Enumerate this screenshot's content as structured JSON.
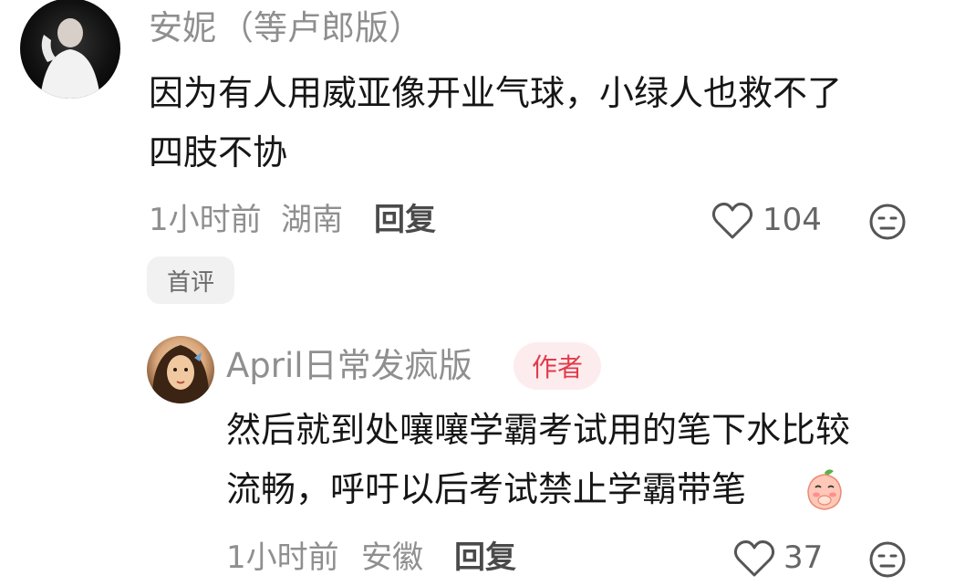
{
  "comments": [
    {
      "username": "安妮",
      "user_suffix": "（等卢郎版）",
      "text_lines": [
        "因为有人用威亚像开业气球，小绿人也救不了",
        "四肢不协"
      ],
      "time": "1小时前",
      "location": "湖南",
      "reply_label": "回复",
      "like_count": "104",
      "tag": "首评"
    },
    {
      "username": "April日常发疯版",
      "badge": "作者",
      "text_lines": [
        "然后就到处嚷嚷学霸考试用的笔下水比较",
        "流畅，呼吁以后考试禁止学霸带笔"
      ],
      "time": "1小时前",
      "location": "安徽",
      "reply_label": "回复",
      "like_count": "37"
    }
  ],
  "icons": {
    "like": "heart-outline-icon",
    "dislike": "unhappy-face-icon",
    "emoji": "peach-covering-mouth-emoji"
  },
  "colors": {
    "author_badge_bg": "#fdecee",
    "author_badge_text": "#e23a4a",
    "meta_text": "#8f8f8f"
  }
}
